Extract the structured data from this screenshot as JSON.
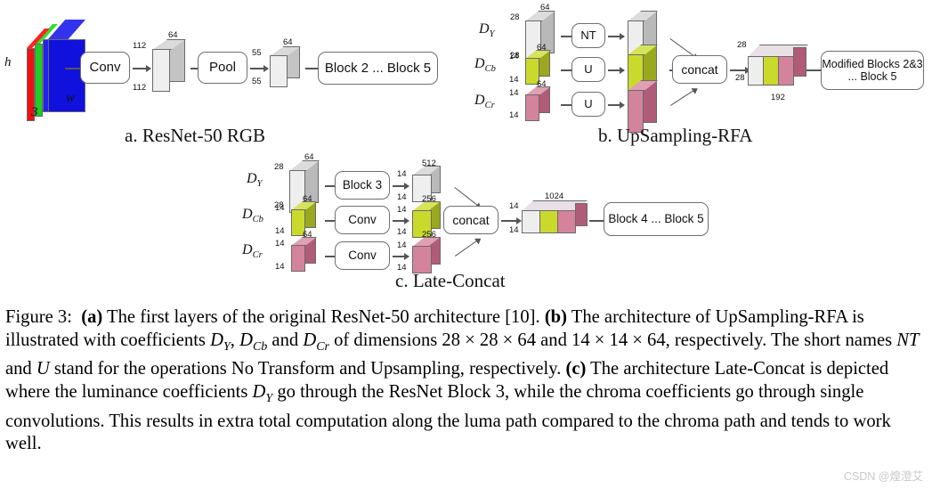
{
  "figure": {
    "caption_label": "Figure 3:",
    "caption_parts": {
      "a_tag": "(a)",
      "a_text": " The first layers of the original ResNet-50 architecture [10]. ",
      "b_tag": "(b)",
      "b_text_1": " The architecture of UpSampling-RFA is illustrated with coefficients ",
      "b_sym_1": "D",
      "b_sub_1": "Y",
      "b_text_2": ", ",
      "b_sym_2": "D",
      "b_sub_2": "Cb",
      "b_text_3": " and ",
      "b_sym_3": "D",
      "b_sub_3": "Cr",
      "b_text_4": " of dimensions 28 × 28 × 64 and 14 × 14 × 64, respectively. The short names ",
      "b_nt": "NT",
      "b_text_5": " and ",
      "b_u": "U",
      "b_text_6": " stand for the operations No Transform and Upsampling, respectively. ",
      "c_tag": "(c)",
      "c_text_1": " The architecture Late-Concat is depicted where the luminance coefficients ",
      "c_sym_1": "D",
      "c_sub_1": "Y",
      "c_text_2": " go through the ResNet Block 3, while the chroma coefficients go through single convolutions. This results in extra total computation along the luma path compared to the chroma path and tends to work well."
    },
    "watermark": "CSDN @煌澄艾"
  },
  "subcaptions": {
    "a": "a. ResNet-50 RGB",
    "b": "b. UpSampling-RFA",
    "c": "c. Late-Concat"
  },
  "panel_a": {
    "input_labels": {
      "h": "h",
      "w": "w",
      "depth": "3"
    },
    "nodes": [
      {
        "label": "Conv"
      },
      {
        "label": "Pool"
      },
      {
        "label": "Block 2 ... Block 5"
      }
    ],
    "tensor_conv": {
      "height": "112",
      "width": "112",
      "depth": "64"
    },
    "tensor_pool": {
      "height": "55",
      "width": "55",
      "depth": "64"
    },
    "colors": {
      "red": "#ee1111",
      "green": "#22cc22",
      "blue": "#1111dd",
      "gray_face": "#efefef",
      "gray_side": "#bfbfbf",
      "gray_top": "#d8d8d8"
    }
  },
  "panel_b": {
    "inputs": [
      {
        "sym": "D",
        "sub": "Y",
        "h": "28",
        "w": "28",
        "d": "64"
      },
      {
        "sym": "D",
        "sub": "Cb",
        "h": "14",
        "w": "14",
        "d": "64"
      },
      {
        "sym": "D",
        "sub": "Cr",
        "h": "14",
        "w": "14",
        "d": "64"
      }
    ],
    "ops": [
      {
        "label": "NT"
      },
      {
        "label": "U"
      },
      {
        "label": "U"
      }
    ],
    "concat_label": "concat",
    "output_tensor": {
      "h": "28",
      "w": "28",
      "d": "192"
    },
    "final_block": {
      "line1": "Modified Blocks 2&3",
      "line2": "... Block 5"
    },
    "colors": {
      "luma": "#eeeeee",
      "luma_side": "#b9b9b9",
      "cb": "#cada2c",
      "cb_side": "#9aa81f",
      "cr": "#d4839d",
      "cr_side": "#b05b77"
    }
  },
  "panel_c": {
    "inputs": [
      {
        "sym": "D",
        "sub": "Y",
        "h": "28",
        "w": "28",
        "d": "64"
      },
      {
        "sym": "D",
        "sub": "Cb",
        "h": "14",
        "w": "14",
        "d": "64"
      },
      {
        "sym": "D",
        "sub": "Cr",
        "h": "14",
        "w": "14",
        "d": "64"
      }
    ],
    "ops": [
      {
        "label": "Block 3"
      },
      {
        "label": "Conv"
      },
      {
        "label": "Conv"
      }
    ],
    "mids": [
      {
        "h": "14",
        "w": "14",
        "d": "512"
      },
      {
        "h": "14",
        "w": "14",
        "d": "256"
      },
      {
        "h": "14",
        "w": "14",
        "d": "256"
      }
    ],
    "concat_label": "concat",
    "output_tensor": {
      "h": "14",
      "w": "14",
      "d": "1024"
    },
    "final_block": {
      "label": "Block 4 ... Block 5"
    }
  }
}
